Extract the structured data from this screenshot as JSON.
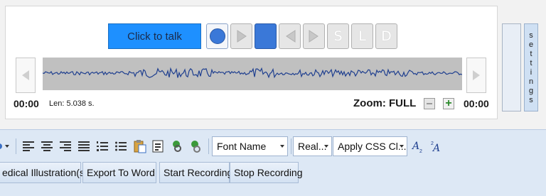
{
  "recorder": {
    "talk_button": "Click to talk",
    "controls": [
      {
        "icon": "record-icon"
      },
      {
        "icon": "play-icon"
      },
      {
        "icon": "stop-icon"
      },
      {
        "icon": "rewind-icon"
      },
      {
        "icon": "fast-forward-icon"
      },
      {
        "icon": "s-icon",
        "label": "S"
      },
      {
        "icon": "l-icon",
        "label": "L"
      },
      {
        "icon": "d-icon",
        "label": "D"
      }
    ],
    "time_start": "00:00",
    "time_end": "00:00",
    "length": "Len: 5.038 s.",
    "zoom": "Zoom: FULL",
    "settings_letters": [
      "s",
      "e",
      "t",
      "t",
      "i",
      "n",
      "g",
      "s"
    ],
    "colors": {
      "accent": "#1e90ff",
      "waveform": "#1f3f8f",
      "wave_bg": "#c0c0c0"
    }
  },
  "toolbar": {
    "font_name": "Font Name",
    "font_size": "Real...",
    "css_class": "Apply CSS Cl...",
    "buttons": {
      "medical": "edical Illustration(s)",
      "export": "Export To Word",
      "start": "Start Recording",
      "stop": "Stop Recording"
    }
  }
}
